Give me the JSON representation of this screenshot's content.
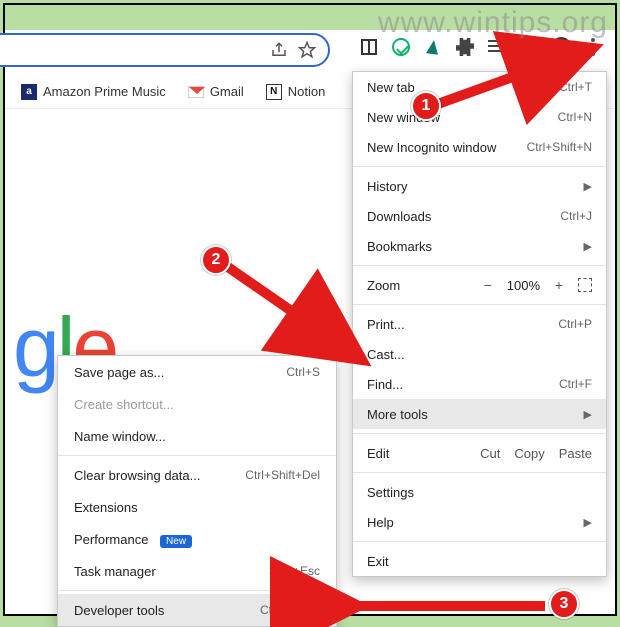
{
  "watermark": "www.wintips.org",
  "bookmarks": {
    "apm": "Amazon Prime Music",
    "gmail": "Gmail",
    "notion": "Notion"
  },
  "main_menu": {
    "new_tab": {
      "label": "New tab",
      "shortcut": "Ctrl+T"
    },
    "new_window": {
      "label": "New window",
      "shortcut": "Ctrl+N"
    },
    "incognito": {
      "label": "New Incognito window",
      "shortcut": "Ctrl+Shift+N"
    },
    "history": {
      "label": "History"
    },
    "downloads": {
      "label": "Downloads",
      "shortcut": "Ctrl+J"
    },
    "bookmarks": {
      "label": "Bookmarks"
    },
    "zoom": {
      "label": "Zoom",
      "value": "100%"
    },
    "print": {
      "label": "Print...",
      "shortcut": "Ctrl+P"
    },
    "cast": {
      "label": "Cast..."
    },
    "find": {
      "label": "Find...",
      "shortcut": "Ctrl+F"
    },
    "more_tools": {
      "label": "More tools"
    },
    "edit": {
      "label": "Edit",
      "cut": "Cut",
      "copy": "Copy",
      "paste": "Paste"
    },
    "settings": {
      "label": "Settings"
    },
    "help": {
      "label": "Help"
    },
    "exit": {
      "label": "Exit"
    }
  },
  "sub_menu": {
    "save_page": {
      "label": "Save page as...",
      "shortcut": "Ctrl+S"
    },
    "create_shortcut": {
      "label": "Create shortcut..."
    },
    "name_window": {
      "label": "Name window..."
    },
    "clear_data": {
      "label": "Clear browsing data...",
      "shortcut": "Ctrl+Shift+Del"
    },
    "extensions": {
      "label": "Extensions"
    },
    "performance": {
      "label": "Performance",
      "badge": "New"
    },
    "task_manager": {
      "label": "Task manager",
      "shortcut": "Shift+Esc"
    },
    "dev_tools": {
      "label": "Developer tools",
      "shortcut": "Ctrl+Shift+I"
    }
  },
  "callouts": {
    "c1": "1",
    "c2": "2",
    "c3": "3"
  }
}
